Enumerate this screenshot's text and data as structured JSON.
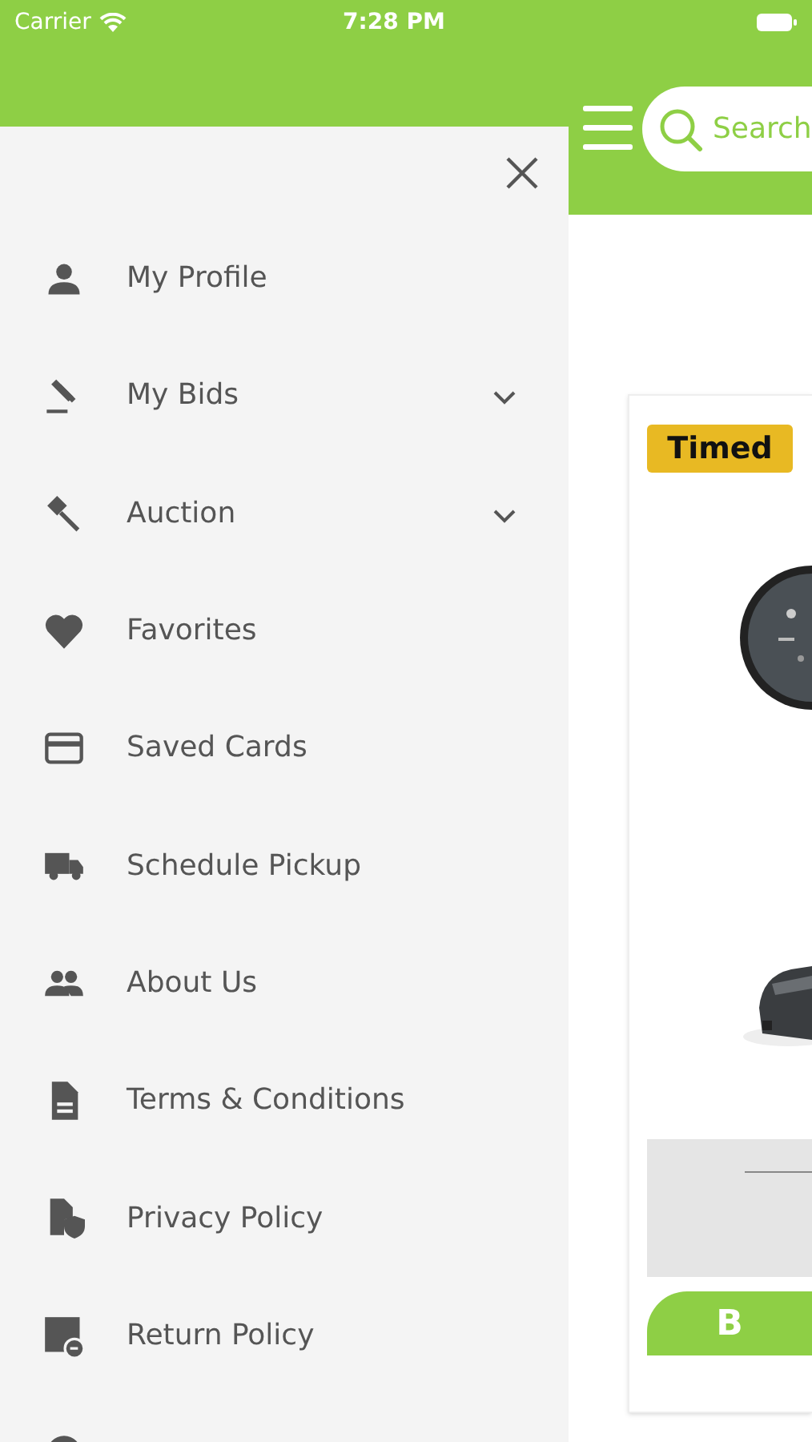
{
  "status_bar": {
    "carrier": "Carrier",
    "time": "7:28 PM"
  },
  "header": {
    "search": {
      "placeholder": "Search"
    }
  },
  "card": {
    "badge": "Timed",
    "button": "B"
  },
  "drawer": {
    "items": [
      {
        "label": "My Profile",
        "expandable": false
      },
      {
        "label": "My Bids",
        "expandable": true
      },
      {
        "label": "Auction",
        "expandable": true
      },
      {
        "label": "Favorites",
        "expandable": false
      },
      {
        "label": "Saved Cards",
        "expandable": false
      },
      {
        "label": "Schedule Pickup",
        "expandable": false
      },
      {
        "label": "About Us",
        "expandable": false
      },
      {
        "label": "Terms & Conditions",
        "expandable": false
      },
      {
        "label": "Privacy Policy",
        "expandable": false
      },
      {
        "label": "Return Policy",
        "expandable": false
      },
      {
        "expandable": false
      }
    ]
  }
}
